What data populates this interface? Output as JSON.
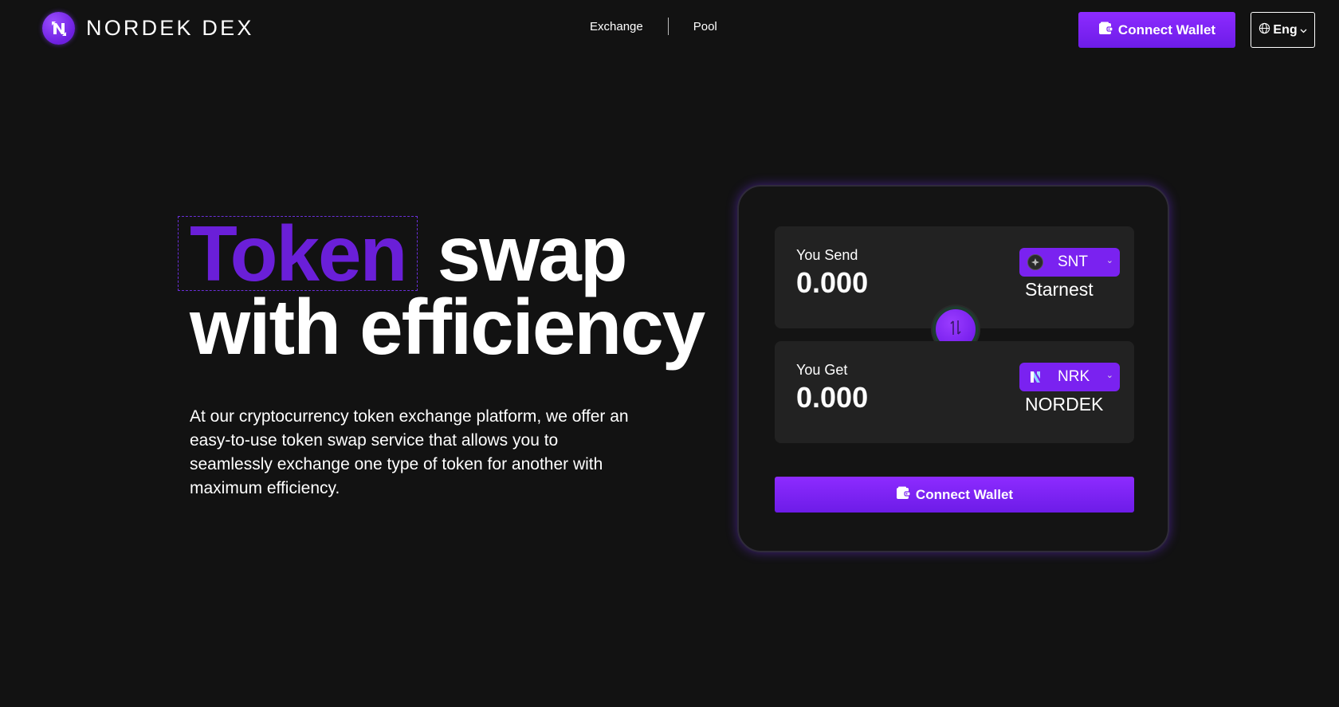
{
  "header": {
    "brand": "NORDEK DEX",
    "nav": [
      {
        "label": "Exchange"
      },
      {
        "label": "Pool"
      }
    ],
    "connect_label": "Connect Wallet",
    "language": "Eng"
  },
  "hero": {
    "title_accent": "Token",
    "title_rest": "swap",
    "title_line2": "with efficiency",
    "description": "At our cryptocurrency token exchange platform, we offer an easy-to-use token swap service that allows you to seamlessly exchange one type of token for another with maximum efficiency."
  },
  "swap": {
    "send": {
      "label": "You Send",
      "amount": "0.000",
      "symbol": "SNT",
      "name": "Starnest"
    },
    "get": {
      "label": "You Get",
      "amount": "0.000",
      "symbol": "NRK",
      "name": "NORDEK"
    },
    "connect_label": "Connect Wallet"
  },
  "colors": {
    "background": "#121212",
    "accent": "#7a22f0",
    "panel": "#222222"
  },
  "icons": [
    "nordek-logo-icon",
    "wallet-icon",
    "globe-icon",
    "chevron-down-icon",
    "starnest-token-icon",
    "nordek-token-icon",
    "swap-arrows-icon"
  ]
}
